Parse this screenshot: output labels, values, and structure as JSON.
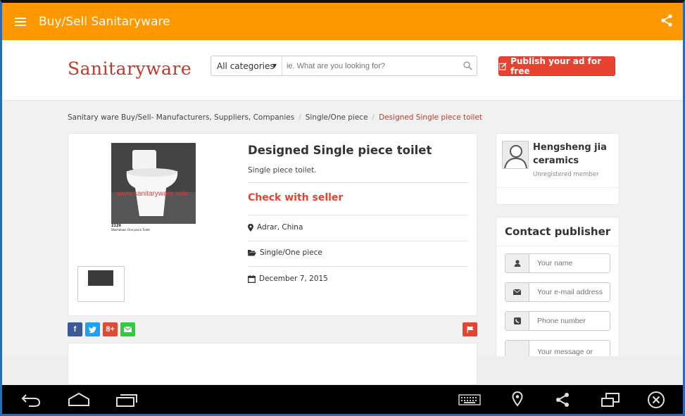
{
  "appbar": {
    "title": "Buy/Sell Sanitaryware",
    "bg_color": "#fe9800",
    "menu_icon": "hamburger-icon",
    "share_icon": "share-icon"
  },
  "header": {
    "logo": "Sanitaryware",
    "category_select": "All categories",
    "search_placeholder": "ie. What are you looking for?",
    "publish_label": "Publish your ad for free"
  },
  "breadcrumb": {
    "items": [
      "Sanitary ware Buy/Sell- Manufacturers, Suppliers, Companies",
      "Single/One piece",
      "Designed Single piece toilet"
    ]
  },
  "listing": {
    "title": "Designed Single piece toilet",
    "subtitle": "Single piece toilet.",
    "price": "Check with seller",
    "location": "Adrar, China",
    "category": "Single/One piece",
    "date": "December 7, 2015",
    "watermark": "www.sanitaryware.sale",
    "caption_code": "2129",
    "caption_name": "Washdown One-piece Toilet"
  },
  "seller": {
    "name": "Hengsheng jia ceramics",
    "status": "Unregistered member"
  },
  "contact": {
    "title": "Contact publisher",
    "name_placeholder": "Your name",
    "email_placeholder": "Your e-mail address",
    "phone_placeholder": "Phone number",
    "message_placeholder": "Your message or"
  },
  "share_buttons": [
    {
      "label": "f",
      "color": "#3b5998"
    },
    {
      "label": "t",
      "color": "#1da1f2"
    },
    {
      "label": "8+",
      "color": "#dd4b39"
    },
    {
      "label": "✉",
      "color": "#2ecc40"
    }
  ]
}
